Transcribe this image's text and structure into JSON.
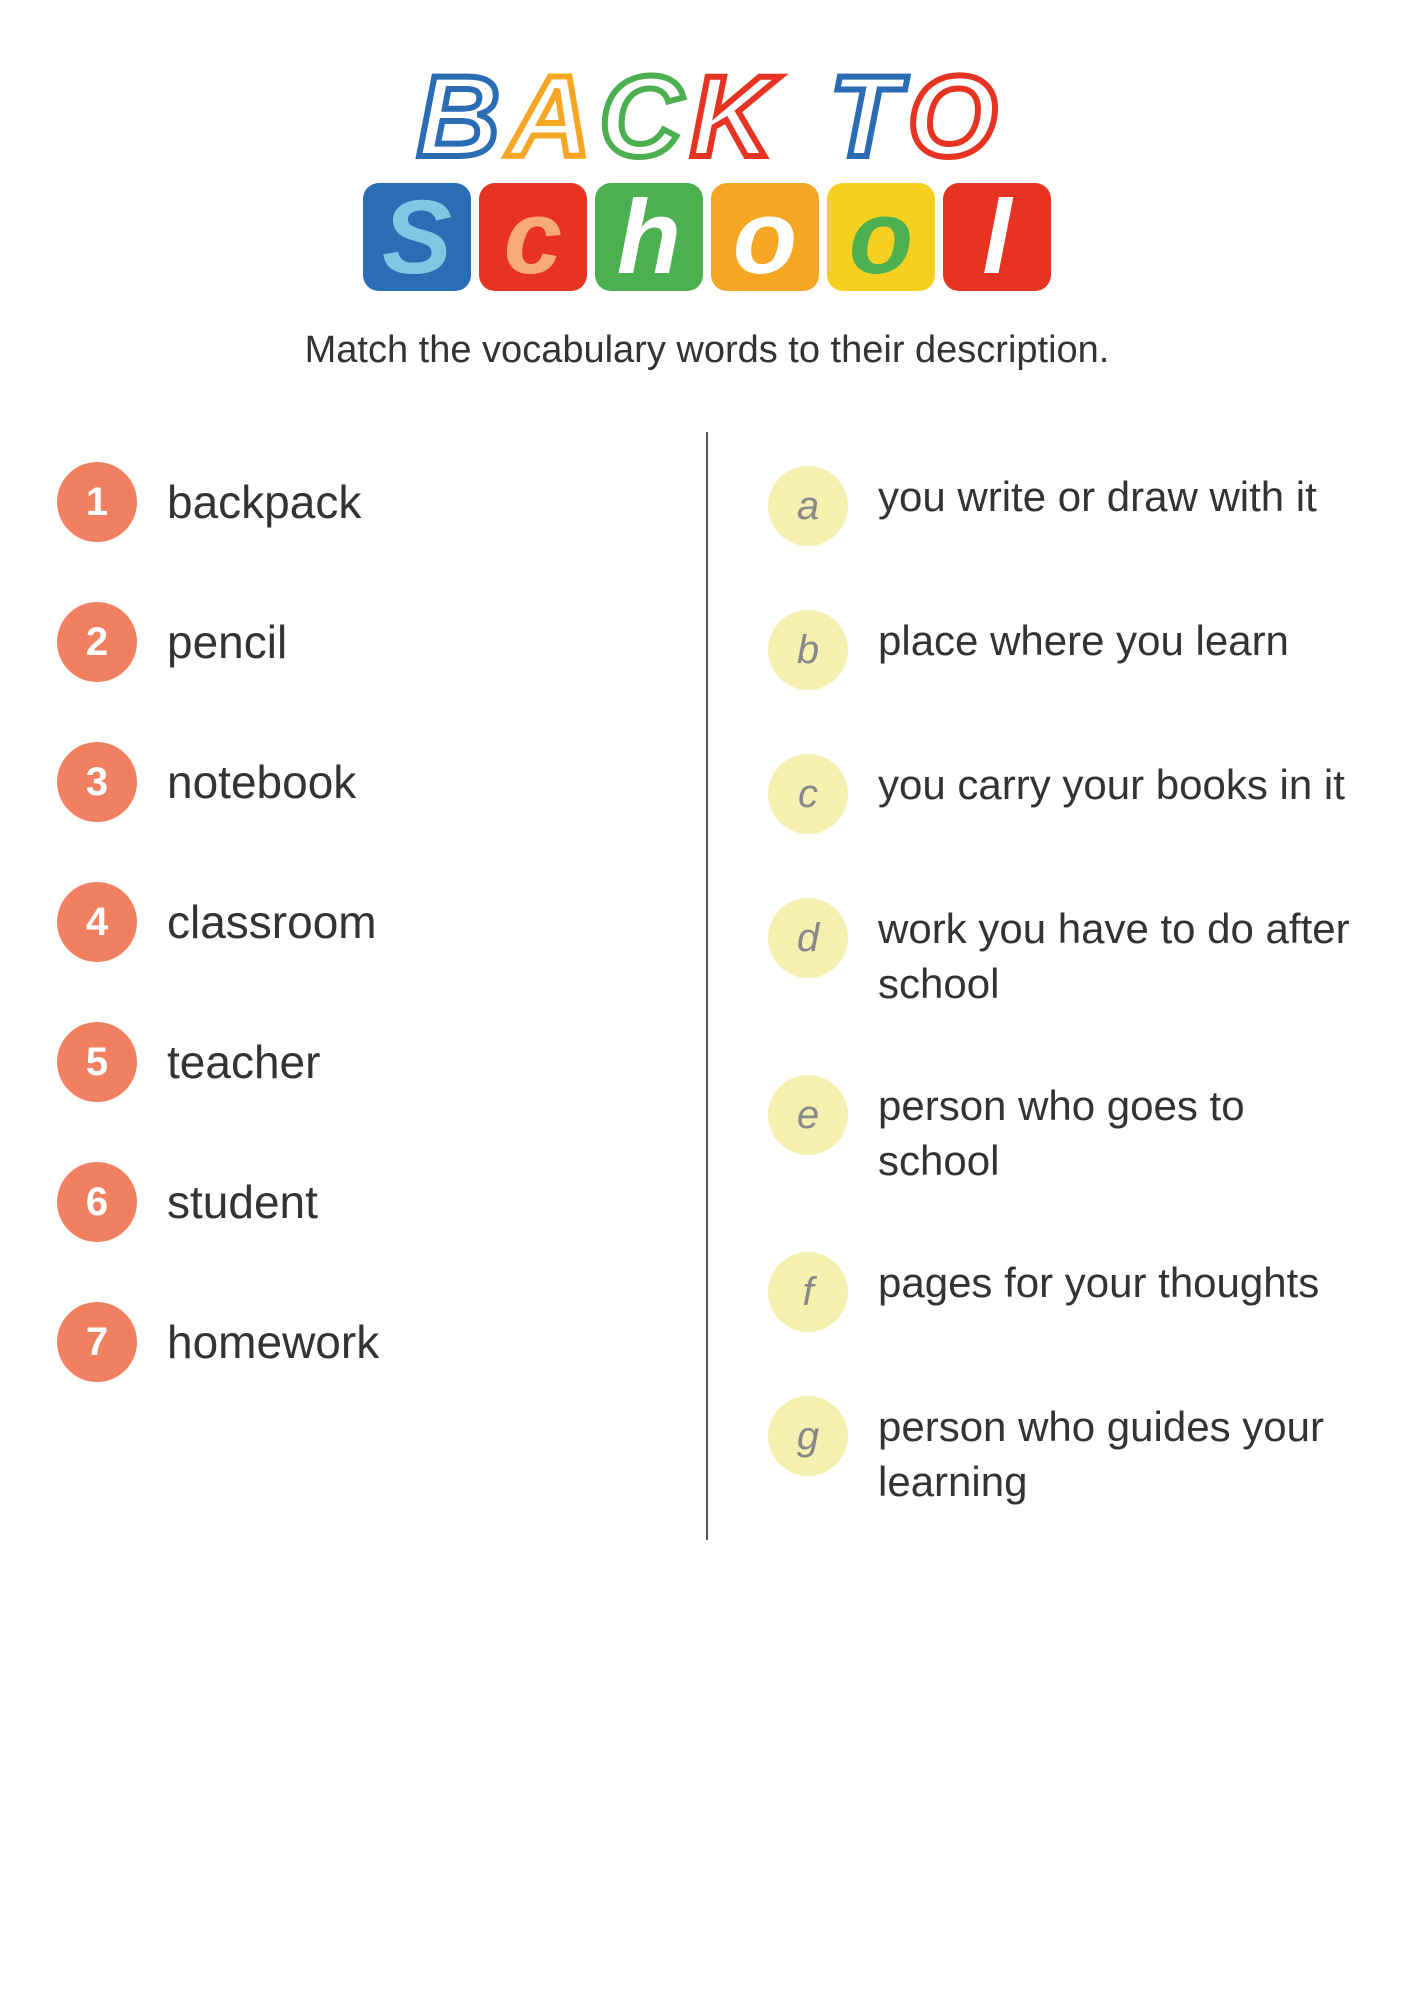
{
  "title": {
    "line1_letters": [
      "B",
      "A",
      "C",
      "K",
      "T",
      "O"
    ],
    "line2_letters": [
      "S",
      "C",
      "H",
      "O",
      "O",
      "L"
    ],
    "display": "BACK TO SCHOOL"
  },
  "subtitle": "Match the vocabulary words to their description.",
  "colors": {
    "salmon": "#f08060",
    "cream_yellow": "#f5f0b0",
    "divider": "#555"
  },
  "left_items": [
    {
      "number": "1",
      "word": "backpack"
    },
    {
      "number": "2",
      "word": "pencil"
    },
    {
      "number": "3",
      "word": "notebook"
    },
    {
      "number": "4",
      "word": "classroom"
    },
    {
      "number": "5",
      "word": "teacher"
    },
    {
      "number": "6",
      "word": "student"
    },
    {
      "number": "7",
      "word": "homework"
    }
  ],
  "right_items": [
    {
      "letter": "a",
      "description": "you write or draw with it"
    },
    {
      "letter": "b",
      "description": "place where you learn"
    },
    {
      "letter": "c",
      "description": "you carry your books in it"
    },
    {
      "letter": "d",
      "description": "work you have to do after school"
    },
    {
      "letter": "e",
      "description": "person who goes to school"
    },
    {
      "letter": "f",
      "description": "pages for your thoughts"
    },
    {
      "letter": "g",
      "description": "person who guides your learning"
    }
  ]
}
